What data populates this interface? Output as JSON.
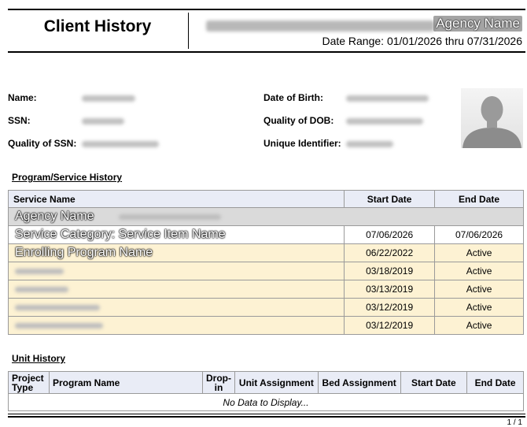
{
  "header": {
    "title": "Client History",
    "agency_overlay": "Agency Name",
    "date_range": "Date Range: 01/01/2026 thru 07/31/2026"
  },
  "client": {
    "name_label": "Name:",
    "dob_label": "Date of Birth:",
    "ssn_label": "SSN:",
    "dob_quality_label": "Quality of DOB:",
    "ssn_quality_label": "Quality of SSN:",
    "unique_id_label": "Unique Identifier:",
    "photo_icon": "person-silhouette-icon"
  },
  "program_history": {
    "title": "Program/Service History",
    "columns": [
      "Service Name",
      "Start Date",
      "End Date"
    ],
    "group_label": "Agency Name",
    "rows": [
      {
        "label": "Service Category: Service Item Name",
        "start": "07/06/2026",
        "end": "07/06/2026"
      },
      {
        "label": "Enrolling Program Name",
        "start": "06/22/2022",
        "end": "Active"
      },
      {
        "label": "",
        "start": "03/18/2019",
        "end": "Active"
      },
      {
        "label": "",
        "start": "03/13/2019",
        "end": "Active"
      },
      {
        "label": "",
        "start": "03/12/2019",
        "end": "Active"
      },
      {
        "label": "",
        "start": "03/12/2019",
        "end": "Active"
      }
    ]
  },
  "unit_history": {
    "title": "Unit History",
    "columns": [
      "Project Type",
      "Program Name",
      "Drop-in",
      "Unit Assignment",
      "Bed Assignment",
      "Start Date",
      "End Date"
    ],
    "empty_text": "No Data to Display..."
  },
  "footer": {
    "page": "1 / 1"
  },
  "colors": {
    "header_bg": "#e9ecf6",
    "active_row_bg": "#fdf2d3",
    "group_row_bg": "#dadada"
  }
}
